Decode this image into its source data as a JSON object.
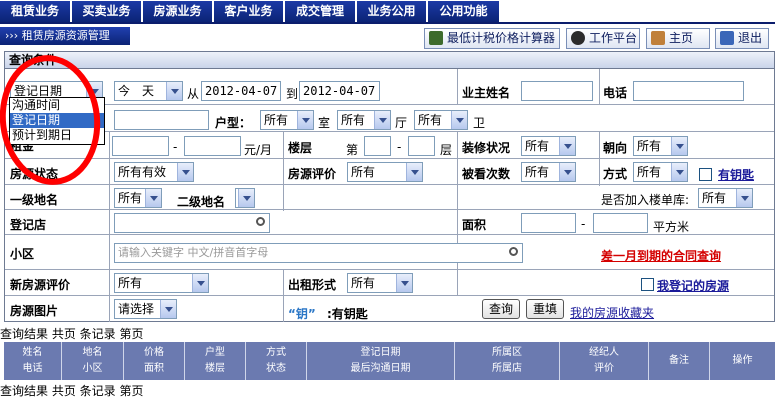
{
  "nav": [
    "租赁业务",
    "买卖业务",
    "房源业务",
    "客户业务",
    "成交管理",
    "业务公用",
    "公用功能"
  ],
  "breadcrumb": "››› 租赁房源资源管理",
  "toolbar": {
    "calc": "最低计税价格计算器",
    "workbench": "工作平台",
    "home": "主页",
    "exit": "退出"
  },
  "form": {
    "header": "查询条件",
    "date_type_selected": "登记日期",
    "date_type_options": [
      "沟通时间",
      "登记日期",
      "预计到期日"
    ],
    "date_range_selected": "今　天",
    "from_label": "从",
    "from_date": "2012-04-07",
    "to_label": "到",
    "to_date": "2012-04-07",
    "owner_label": "业主姓名",
    "phone_label": "电话",
    "layout_label": "户型：",
    "layout_room": "所有",
    "room_unit": "室",
    "layout_hall": "所有",
    "hall_unit": "厅",
    "layout_bath": "所有",
    "bath_unit": "卫",
    "rent_label": "租金",
    "rent_dash": "-",
    "rent_unit": "元/月",
    "floor_label": "楼层",
    "floor_prefix": "第",
    "floor_dash": "-",
    "floor_unit": "层",
    "decor_label": "装修状况",
    "decor_value": "所有",
    "orient_label": "朝向",
    "orient_value": "所有",
    "status_label": "房源状态",
    "status_value": "所有有效",
    "rating_label": "房源评价",
    "rating_value": "所有",
    "viewed_label": "被看次数",
    "viewed_value": "所有",
    "method_label": "方式",
    "method_value": "所有",
    "haskey_label": "有钥匙",
    "area1_label": "一级地名",
    "area1_value": "所有",
    "area2_label": "二级地名",
    "area2_value": "",
    "single_label": "是否加入楼单库:",
    "single_value": "所有",
    "store_label": "登记店",
    "size_label": "面积",
    "size_dash": "-",
    "size_unit": "平方米",
    "community_label": "小区",
    "community_placeholder": "请输入关键字 中文/拼音首字母",
    "expire_link": "差一月到期的合同查询",
    "new_rating_label": "新房源评价",
    "new_rating_value": "所有",
    "rent_type_label": "出租形式",
    "rent_type_value": "所有",
    "mine_label": "我登记的房源",
    "photo_label": "房源图片",
    "photo_value": "请选择",
    "key_hint_key": "“钥”",
    "key_hint_text": ":有钥匙",
    "query_btn": "查询",
    "reset_btn": "重填",
    "fav_link": "我的房源收藏夹"
  },
  "results": {
    "summary": "查询结果 共页 条记录 第页",
    "columns": [
      [
        "姓名",
        "电话"
      ],
      [
        "地名",
        "小区"
      ],
      [
        "价格",
        "面积"
      ],
      [
        "户型",
        "楼层"
      ],
      [
        "方式",
        "状态"
      ],
      [
        "登记日期",
        "最后沟通日期"
      ],
      [
        "所属区",
        "所属店"
      ],
      [
        "经纪人",
        "评价"
      ],
      [
        "备注",
        ""
      ],
      [
        "操作",
        ""
      ]
    ]
  }
}
